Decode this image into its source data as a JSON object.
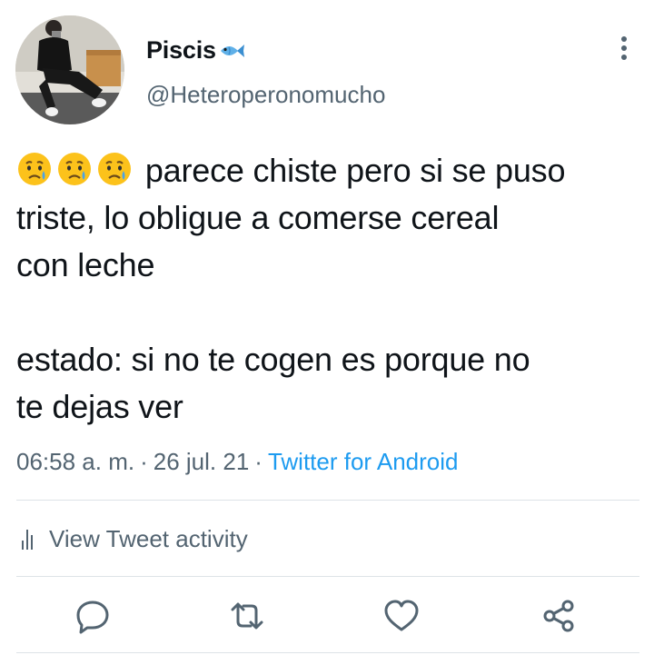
{
  "user": {
    "display_name": "Piscis",
    "name_emoji": "fish-emoji",
    "handle": "@Heteroperonomucho",
    "avatar": "profile-photo"
  },
  "tweet": {
    "emoji_prefix": "😥😥😥",
    "line1": "parece chiste pero si se puso",
    "line2": "triste, lo obligue a comerse cereal",
    "line3": "con leche",
    "line4": "estado: si no te cogen es porque no",
    "line5": "te dejas ver"
  },
  "meta": {
    "time": "06:58 a. m.",
    "separator": "·",
    "date": "26 jul. 21",
    "source": "Twitter for Android"
  },
  "activity": {
    "label": "View Tweet activity",
    "icon": "bar-chart-icon"
  },
  "actions": [
    {
      "name": "reply",
      "icon": "reply-icon"
    },
    {
      "name": "retweet",
      "icon": "retweet-icon"
    },
    {
      "name": "like",
      "icon": "heart-icon"
    },
    {
      "name": "share",
      "icon": "share-icon"
    }
  ],
  "colors": {
    "text": "#0f1419",
    "secondary": "#536471",
    "accent": "#1d9bf0",
    "divider": "#dde3e7"
  }
}
